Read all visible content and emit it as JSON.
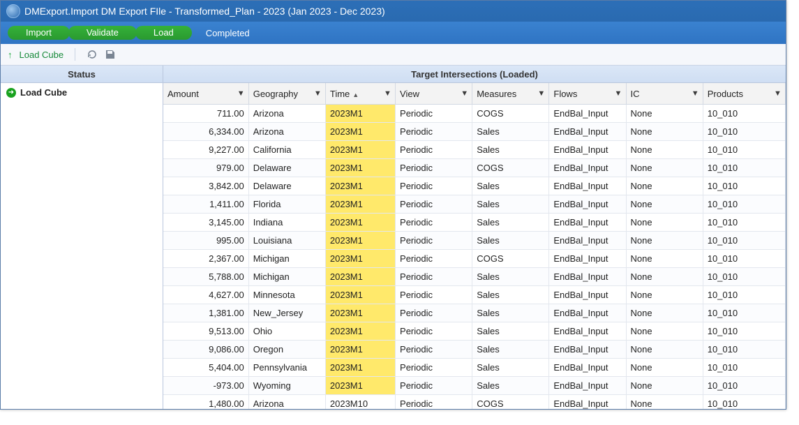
{
  "title": "DMExport.Import DM Export FIle  -  Transformed_Plan  -  2023 (Jan 2023 - Dec 2023)",
  "steps": {
    "import": "Import",
    "validate": "Validate",
    "load": "Load",
    "stage": "Completed"
  },
  "toolbar": {
    "load_cube": "Load Cube"
  },
  "left": {
    "header": "Status",
    "node": "Load Cube"
  },
  "right": {
    "header": "Target Intersections (Loaded)"
  },
  "columns": {
    "amount": "Amount",
    "geography": "Geography",
    "time": "Time",
    "view": "View",
    "measures": "Measures",
    "flows": "Flows",
    "ic": "IC",
    "products": "Products"
  },
  "rows": [
    {
      "amount": "711.00",
      "geography": "Arizona",
      "time": "2023M1",
      "view": "Periodic",
      "measures": "COGS",
      "flows": "EndBal_Input",
      "ic": "None",
      "products": "10_010",
      "hl": true
    },
    {
      "amount": "6,334.00",
      "geography": "Arizona",
      "time": "2023M1",
      "view": "Periodic",
      "measures": "Sales",
      "flows": "EndBal_Input",
      "ic": "None",
      "products": "10_010",
      "hl": true
    },
    {
      "amount": "9,227.00",
      "geography": "California",
      "time": "2023M1",
      "view": "Periodic",
      "measures": "Sales",
      "flows": "EndBal_Input",
      "ic": "None",
      "products": "10_010",
      "hl": true
    },
    {
      "amount": "979.00",
      "geography": "Delaware",
      "time": "2023M1",
      "view": "Periodic",
      "measures": "COGS",
      "flows": "EndBal_Input",
      "ic": "None",
      "products": "10_010",
      "hl": true
    },
    {
      "amount": "3,842.00",
      "geography": "Delaware",
      "time": "2023M1",
      "view": "Periodic",
      "measures": "Sales",
      "flows": "EndBal_Input",
      "ic": "None",
      "products": "10_010",
      "hl": true
    },
    {
      "amount": "1,411.00",
      "geography": "Florida",
      "time": "2023M1",
      "view": "Periodic",
      "measures": "Sales",
      "flows": "EndBal_Input",
      "ic": "None",
      "products": "10_010",
      "hl": true
    },
    {
      "amount": "3,145.00",
      "geography": "Indiana",
      "time": "2023M1",
      "view": "Periodic",
      "measures": "Sales",
      "flows": "EndBal_Input",
      "ic": "None",
      "products": "10_010",
      "hl": true
    },
    {
      "amount": "995.00",
      "geography": "Louisiana",
      "time": "2023M1",
      "view": "Periodic",
      "measures": "Sales",
      "flows": "EndBal_Input",
      "ic": "None",
      "products": "10_010",
      "hl": true
    },
    {
      "amount": "2,367.00",
      "geography": "Michigan",
      "time": "2023M1",
      "view": "Periodic",
      "measures": "COGS",
      "flows": "EndBal_Input",
      "ic": "None",
      "products": "10_010",
      "hl": true
    },
    {
      "amount": "5,788.00",
      "geography": "Michigan",
      "time": "2023M1",
      "view": "Periodic",
      "measures": "Sales",
      "flows": "EndBal_Input",
      "ic": "None",
      "products": "10_010",
      "hl": true
    },
    {
      "amount": "4,627.00",
      "geography": "Minnesota",
      "time": "2023M1",
      "view": "Periodic",
      "measures": "Sales",
      "flows": "EndBal_Input",
      "ic": "None",
      "products": "10_010",
      "hl": true
    },
    {
      "amount": "1,381.00",
      "geography": "New_Jersey",
      "time": "2023M1",
      "view": "Periodic",
      "measures": "Sales",
      "flows": "EndBal_Input",
      "ic": "None",
      "products": "10_010",
      "hl": true
    },
    {
      "amount": "9,513.00",
      "geography": "Ohio",
      "time": "2023M1",
      "view": "Periodic",
      "measures": "Sales",
      "flows": "EndBal_Input",
      "ic": "None",
      "products": "10_010",
      "hl": true
    },
    {
      "amount": "9,086.00",
      "geography": "Oregon",
      "time": "2023M1",
      "view": "Periodic",
      "measures": "Sales",
      "flows": "EndBal_Input",
      "ic": "None",
      "products": "10_010",
      "hl": true
    },
    {
      "amount": "5,404.00",
      "geography": "Pennsylvania",
      "time": "2023M1",
      "view": "Periodic",
      "measures": "Sales",
      "flows": "EndBal_Input",
      "ic": "None",
      "products": "10_010",
      "hl": true
    },
    {
      "amount": "-973.00",
      "geography": "Wyoming",
      "time": "2023M1",
      "view": "Periodic",
      "measures": "Sales",
      "flows": "EndBal_Input",
      "ic": "None",
      "products": "10_010",
      "hl": true
    },
    {
      "amount": "1,480.00",
      "geography": "Arizona",
      "time": "2023M10",
      "view": "Periodic",
      "measures": "COGS",
      "flows": "EndBal_Input",
      "ic": "None",
      "products": "10_010",
      "hl": false
    }
  ]
}
